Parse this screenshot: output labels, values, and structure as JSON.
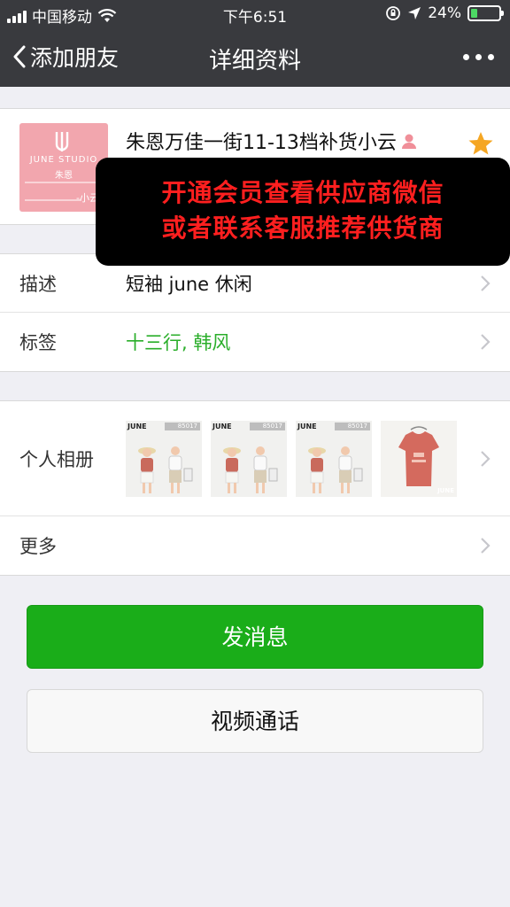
{
  "status_bar": {
    "carrier": "中国移动",
    "time": "下午6:51",
    "battery_percent": "24%",
    "battery_level": 0.24,
    "signal_bars": 4
  },
  "nav": {
    "back_label": "添加朋友",
    "title": "详细资料"
  },
  "profile": {
    "avatar_studio": "JUNE STUDIO",
    "avatar_name": "朱恩",
    "avatar_sign": "-小云",
    "display_name": "朱恩万佳一街11-13档补货小云",
    "starred": true
  },
  "promo": {
    "line1": "开通会员查看供应商微信",
    "line2": "或者联系客服推荐供货商"
  },
  "details": {
    "description_label": "描述",
    "description_value": "短袖 june 休闲",
    "tags_label": "标签",
    "tags_value": "十三行, 韩风"
  },
  "album": {
    "label": "个人相册",
    "thumbs": [
      {
        "brand": "JUNE",
        "code": "85017"
      },
      {
        "brand": "JUNE",
        "code": "85017"
      },
      {
        "brand": "JUNE",
        "code": "85017"
      },
      {
        "brand": "JUNE",
        "code": ""
      }
    ],
    "more_label": "更多"
  },
  "actions": {
    "send_message": "发消息",
    "video_call": "视频通话"
  },
  "colors": {
    "nav_bg": "#393a3e",
    "green": "#1aad19",
    "tag_green": "#2aae2a",
    "promo_text": "#ff1f1f",
    "star": "#f5a623"
  }
}
